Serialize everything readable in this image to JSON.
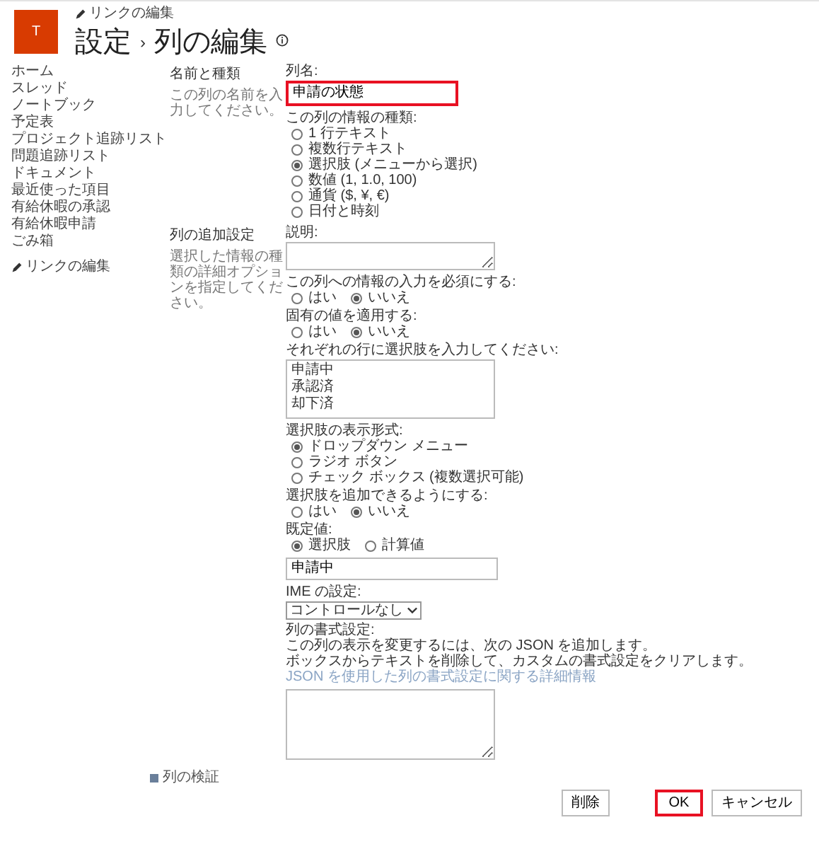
{
  "header": {
    "logo_letter": "T",
    "edit_link": "リンクの編集",
    "title": "設定",
    "separator": "›",
    "subtitle": "列の編集"
  },
  "nav": {
    "items": [
      "ホーム",
      "スレッド",
      "ノートブック",
      "予定表",
      "プロジェクト追跡リスト",
      "問題追跡リスト",
      "ドキュメント",
      "最近使った項目",
      "有給休暇の承認",
      "有給休暇申請",
      "ごみ箱"
    ],
    "edit_link": "リンクの編集"
  },
  "sections": [
    {
      "heading": "名前と種類",
      "description": "この列の名前を入力してください。",
      "fields": [
        {
          "kind": "text",
          "label": "列名:",
          "value": "申請の状態",
          "highlighted": true
        },
        {
          "kind": "radio-list",
          "label": "この列の情報の種類:",
          "options": [
            {
              "label": "1 行テキスト",
              "selected": false
            },
            {
              "label": "複数行テキスト",
              "selected": false
            },
            {
              "label": "選択肢 (メニューから選択)",
              "selected": true
            },
            {
              "label": "数値 (1, 1.0, 100)",
              "selected": false
            },
            {
              "label": "通貨 ($, ¥, €)",
              "selected": false
            },
            {
              "label": "日付と時刻",
              "selected": false
            }
          ]
        }
      ]
    },
    {
      "heading": "列の追加設定",
      "description": "選択した情報の種類の詳細オプションを指定してください。",
      "fields": [
        {
          "kind": "textarea",
          "label": "説明:"
        },
        {
          "kind": "radio-row",
          "label": "この列への情報の入力を必須にする:",
          "options": [
            {
              "label": "はい",
              "selected": false
            },
            {
              "label": "いいえ",
              "selected": true
            }
          ]
        },
        {
          "kind": "radio-row",
          "label": "固有の値を適用する:",
          "options": [
            {
              "label": "はい",
              "selected": false
            },
            {
              "label": "いいえ",
              "selected": true
            }
          ]
        },
        {
          "kind": "textarea",
          "label": "それぞれの行に選択肢を入力してください:",
          "lines": [
            "申請中",
            "承認済",
            "却下済"
          ]
        },
        {
          "kind": "radio-list",
          "label": "選択肢の表示形式:",
          "options": [
            {
              "label": "ドロップダウン メニュー",
              "selected": true
            },
            {
              "label": "ラジオ ボタン",
              "selected": false
            },
            {
              "label": "チェック ボックス (複数選択可能)",
              "selected": false
            }
          ]
        },
        {
          "kind": "radio-row",
          "label": "選択肢を追加できるようにする:",
          "options": [
            {
              "label": "はい",
              "selected": false
            },
            {
              "label": "いいえ",
              "selected": true
            }
          ]
        },
        {
          "kind": "radio-row",
          "label": "既定値:",
          "options": [
            {
              "label": "選択肢",
              "selected": true
            },
            {
              "label": "計算値",
              "selected": false
            }
          ]
        },
        {
          "kind": "text",
          "value": "申請中",
          "highlighted": false
        },
        {
          "kind": "select",
          "label": "IME の設定:",
          "value": "コントロールなし"
        },
        {
          "kind": "note",
          "label": "列の書式設定:",
          "lines": [
            "この列の表示を変更するには、次の JSON を追加します。",
            "ボックスからテキストを削除して、カスタムの書式設定をクリアします。"
          ],
          "link": "JSON を使用した列の書式設定に関する詳細情報"
        },
        {
          "kind": "textarea",
          "tall": true
        }
      ]
    }
  ],
  "validation_link": "列の検証",
  "buttons": [
    {
      "label": "削除",
      "highlighted": false
    },
    {
      "label": "OK",
      "highlighted": true
    },
    {
      "label": "キャンセル",
      "highlighted": false
    }
  ]
}
